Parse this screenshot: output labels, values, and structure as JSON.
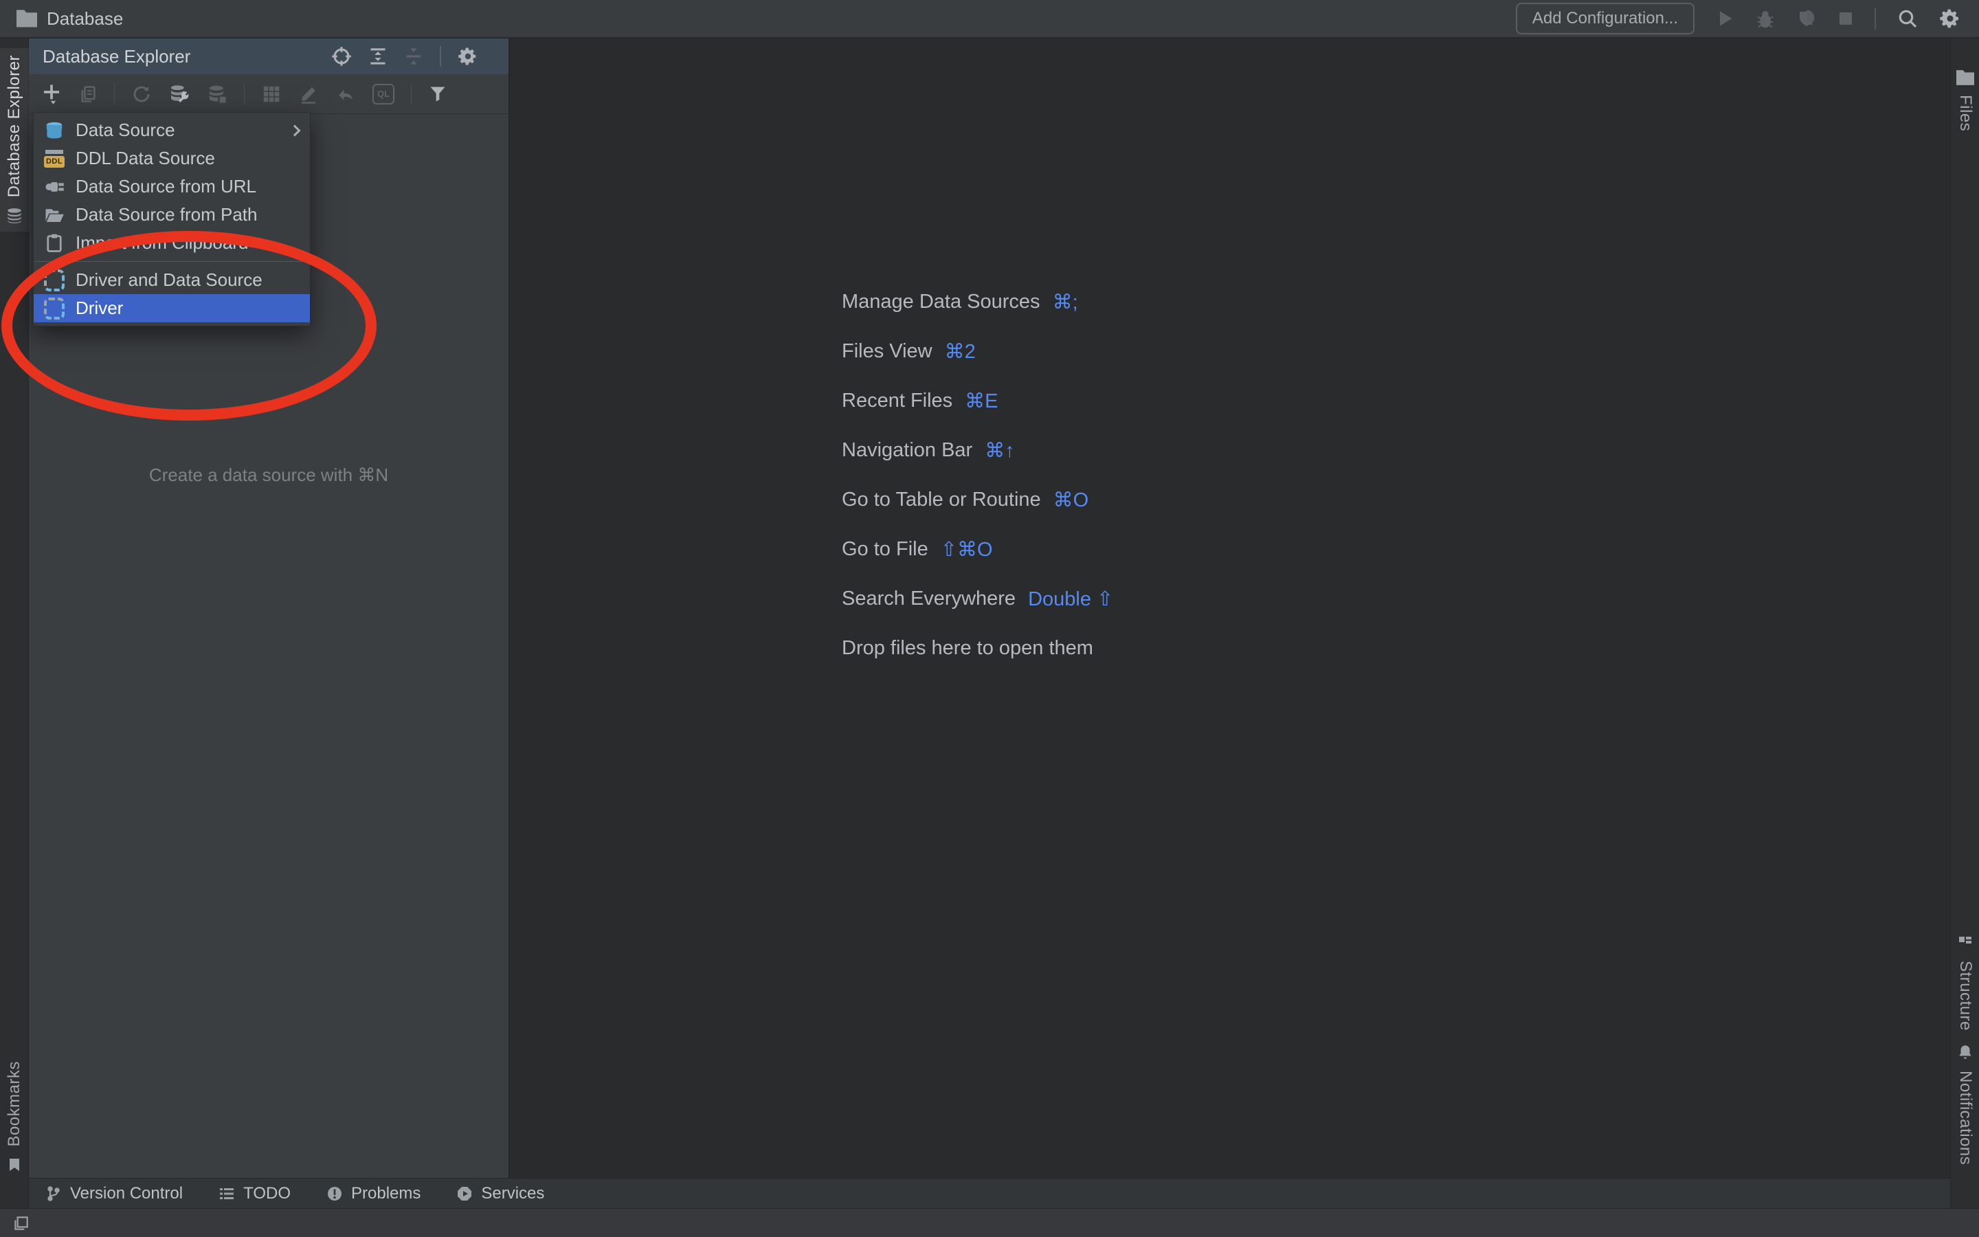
{
  "titlebar": {
    "project": "Database",
    "add_configuration_label": "Add Configuration..."
  },
  "left_stripe": {
    "database_explorer_label": "Database Explorer",
    "bookmarks_label": "Bookmarks"
  },
  "right_stripe": {
    "files_label": "Files",
    "structure_label": "Structure",
    "notifications_label": "Notifications"
  },
  "panel": {
    "title": "Database Explorer",
    "hint": "Create a data source with ⌘N",
    "ql_badge": "QL"
  },
  "menu": {
    "ddl_badge": "DDL",
    "items": [
      {
        "label": "Data Source",
        "icon": "database-icon",
        "has_submenu": true
      },
      {
        "label": "DDL Data Source",
        "icon": "ddl-icon"
      },
      {
        "label": "Data Source from URL",
        "icon": "plug-icon"
      },
      {
        "label": "Data Source from Path",
        "icon": "folder-open-icon"
      },
      {
        "label": "Import from Clipboard",
        "icon": "clipboard-icon"
      },
      {
        "label": "Driver and Data Source",
        "icon": "driver-icon"
      },
      {
        "label": "Driver",
        "icon": "driver-icon",
        "selected": true
      }
    ]
  },
  "shortcuts": [
    {
      "label": "Manage Data Sources",
      "keys": "⌘;"
    },
    {
      "label": "Files View",
      "keys": "⌘2"
    },
    {
      "label": "Recent Files",
      "keys": "⌘E"
    },
    {
      "label": "Navigation Bar",
      "keys": "⌘↑"
    },
    {
      "label": "Go to Table or Routine",
      "keys": "⌘O"
    },
    {
      "label": "Go to File",
      "keys": "⇧⌘O"
    },
    {
      "label": "Search Everywhere",
      "keys": "Double ⇧"
    },
    {
      "label": "Drop files here to open them",
      "keys": ""
    }
  ],
  "bottombar": {
    "items": [
      {
        "label": "Version Control"
      },
      {
        "label": "TODO"
      },
      {
        "label": "Problems"
      },
      {
        "label": "Services"
      }
    ]
  },
  "colors": {
    "accent_blue": "#548AF7",
    "selection_blue": "#3E63C7",
    "annotation_red": "#E8341F",
    "datasource_blue": "#4E9CCB",
    "ddl_yellow": "#D3A94C"
  }
}
